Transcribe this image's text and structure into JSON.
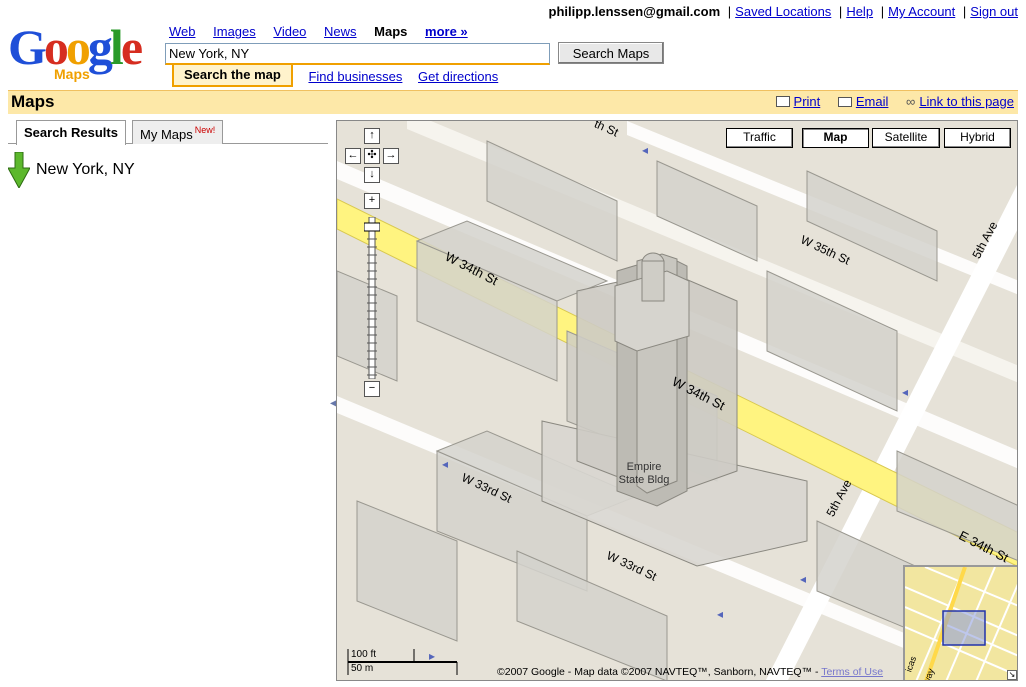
{
  "header": {
    "logo_text": "Google",
    "logo_sub": "Maps",
    "user_email": "philipp.lenssen@gmail.com",
    "user_links": [
      "Saved Locations",
      "Help",
      "My Account",
      "Sign out"
    ],
    "nav": {
      "web": "Web",
      "images": "Images",
      "video": "Video",
      "news": "News",
      "maps": "Maps",
      "more": "more »"
    },
    "search_value": "New York, NY",
    "search_button": "Search Maps",
    "subtabs": {
      "search": "Search the map",
      "find": "Find businesses",
      "directions": "Get directions"
    }
  },
  "titlebar": {
    "title": "Maps",
    "print": "Print",
    "email": "Email",
    "link": "Link to this page"
  },
  "left": {
    "tab_results": "Search Results",
    "tab_mymaps": "My Maps",
    "new_badge": "New!",
    "result": "New York, NY"
  },
  "map": {
    "types": {
      "traffic": "Traffic",
      "map": "Map",
      "satellite": "Satellite",
      "hybrid": "Hybrid"
    },
    "streets": {
      "w34_a": "W 34th St",
      "w34_b": "W 34th St",
      "w35": "W 35th St",
      "w33_a": "W 33rd St",
      "w33_b": "W 33rd St",
      "fifth_a": "5th Ave",
      "fifth_b": "5th Ave",
      "e34": "E 34th St",
      "top_st": "th St"
    },
    "landmark": [
      "Empire",
      "State Bldg"
    ],
    "scale_ft": "100 ft",
    "scale_m": "50 m",
    "copyright": "©2007 Google - Map data ©2007 NAVTEQ™, Sanborn, NAVTEQ™ -",
    "terms": "Terms of Use",
    "overview_labels": [
      "icas",
      "dway"
    ]
  },
  "colors": {
    "logo_blue": "#1f4fd8",
    "logo_red": "#d62d20",
    "logo_yellow": "#f0a000",
    "logo_green": "#2a9a2a",
    "title_bg": "#fde8a8",
    "road_yellow": "#fff480",
    "pin_green": "#5cb82c"
  }
}
